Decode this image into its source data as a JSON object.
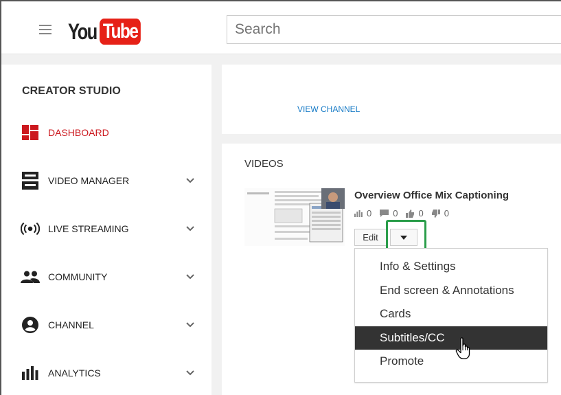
{
  "header": {
    "logo_you": "You",
    "logo_tube": "Tube",
    "search_placeholder": "Search"
  },
  "sidebar": {
    "title": "CREATOR STUDIO",
    "items": [
      {
        "label": "DASHBOARD",
        "icon": "dashboard-icon",
        "active": true,
        "expandable": false
      },
      {
        "label": "VIDEO MANAGER",
        "icon": "video-manager-icon",
        "active": false,
        "expandable": true
      },
      {
        "label": "LIVE STREAMING",
        "icon": "live-streaming-icon",
        "active": false,
        "expandable": true
      },
      {
        "label": "COMMUNITY",
        "icon": "community-icon",
        "active": false,
        "expandable": true
      },
      {
        "label": "CHANNEL",
        "icon": "channel-icon",
        "active": false,
        "expandable": true
      },
      {
        "label": "ANALYTICS",
        "icon": "analytics-icon",
        "active": false,
        "expandable": true
      }
    ]
  },
  "main": {
    "view_channel_label": "VIEW CHANNEL",
    "videos_title": "VIDEOS",
    "video": {
      "title": "Overview Office Mix Captioning",
      "views": "0",
      "comments": "0",
      "likes": "0",
      "dislikes": "0",
      "edit_label": "Edit"
    },
    "menu": {
      "items": [
        "Info & Settings",
        "End screen & Annotations",
        "Cards",
        "Subtitles/CC",
        "Promote"
      ],
      "selected_index": 3
    }
  },
  "colors": {
    "brand_red": "#e62117",
    "active_red": "#cc181e",
    "link_blue": "#167ac6",
    "highlight_green": "#2a9d4a",
    "menu_selected_bg": "#333333"
  }
}
